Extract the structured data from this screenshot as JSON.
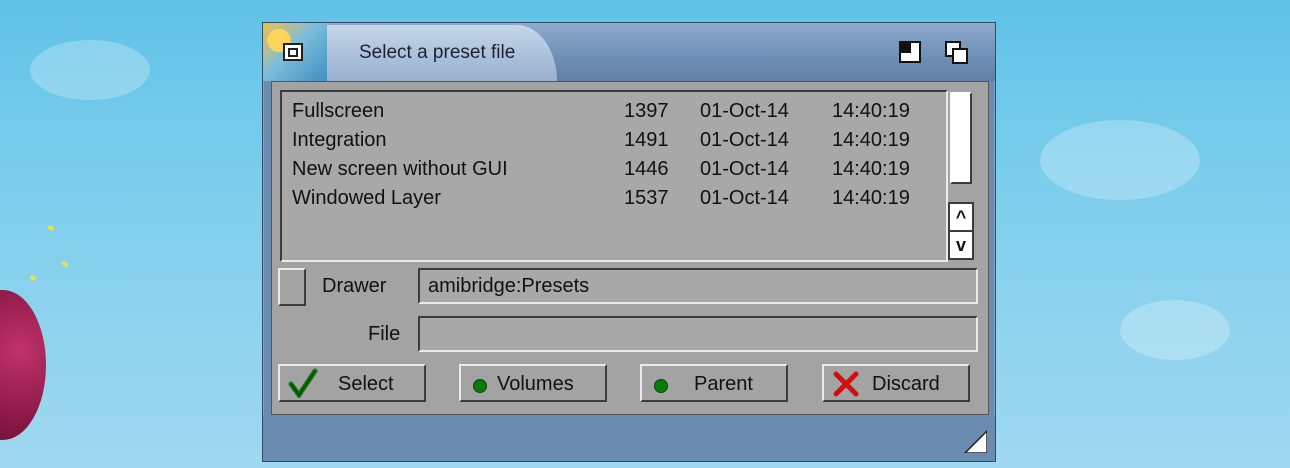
{
  "window": {
    "title": "Select a preset file"
  },
  "files": [
    {
      "name": "Fullscreen",
      "size": "1397",
      "date": "01-Oct-14",
      "time": "14:40:19"
    },
    {
      "name": "Integration",
      "size": "1491",
      "date": "01-Oct-14",
      "time": "14:40:19"
    },
    {
      "name": "New screen without GUI",
      "size": "1446",
      "date": "01-Oct-14",
      "time": "14:40:19"
    },
    {
      "name": "Windowed Layer",
      "size": "1537",
      "date": "01-Oct-14",
      "time": "14:40:19"
    }
  ],
  "scrollbar": {
    "up_label": "^",
    "down_label": "v"
  },
  "drawer": {
    "label": "Drawer",
    "value": "amibridge:Presets"
  },
  "file": {
    "label": "File",
    "value": ""
  },
  "buttons": {
    "select": "Select",
    "volumes": "Volumes",
    "parent": "Parent",
    "discard": "Discard"
  },
  "icons": {
    "close": "close-icon",
    "zoom": "zoom-icon",
    "depth": "depth-icon",
    "check": "checkmark-icon",
    "discard": "x-icon",
    "resize": "resize-icon"
  },
  "colors": {
    "window_blue": "#6b8cb1",
    "panel_gray": "#a3a3a3",
    "green": "#0a7a0a",
    "red": "#d01010"
  }
}
